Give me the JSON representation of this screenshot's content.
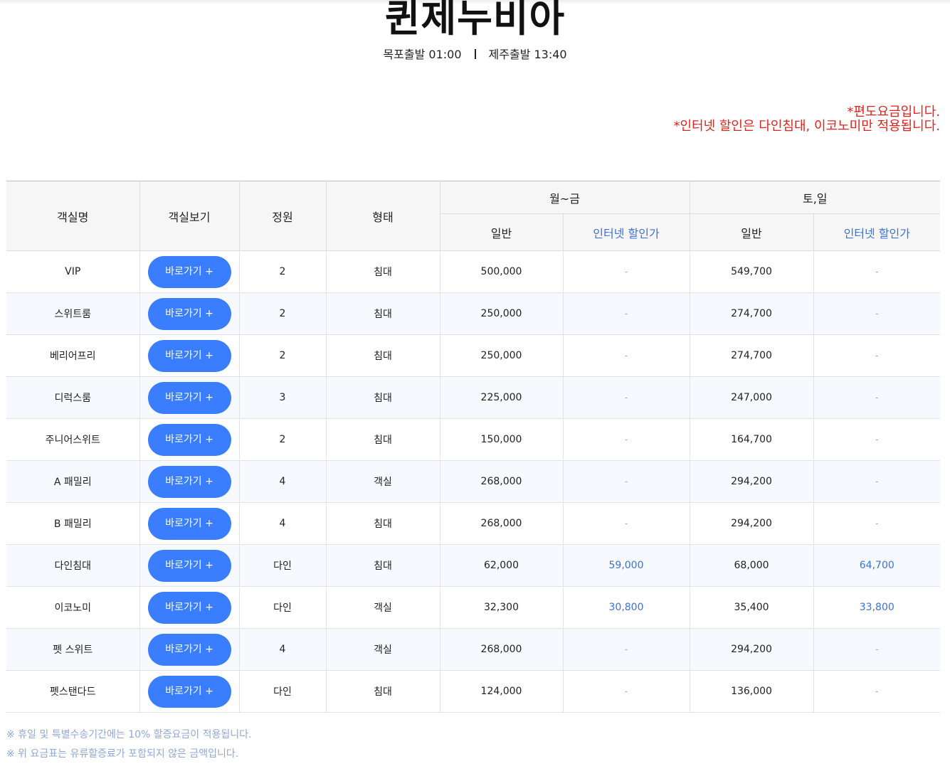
{
  "ship_name": "퀸제누비아",
  "schedule": {
    "depart_mokpo": "목포출발 01:00",
    "depart_jeju": "제주출발 13:40"
  },
  "notices": [
    "*편도요금입니다.",
    "*인터넷 할인은 다인침대, 이코노미만 적용됩니다."
  ],
  "table": {
    "headers": {
      "room_name": "객실명",
      "room_view": "객실보기",
      "capacity": "정원",
      "type": "형태",
      "weekday": "월~금",
      "weekend": "토,일",
      "regular": "일반",
      "internet": "인터넷 할인가"
    },
    "button_label": "바로가기 +",
    "rows": [
      {
        "name": "VIP",
        "capacity": "2",
        "type": "침대",
        "wd_regular": "500,000",
        "wd_internet": "-",
        "we_regular": "549,700",
        "we_internet": "-"
      },
      {
        "name": "스위트룸",
        "capacity": "2",
        "type": "침대",
        "wd_regular": "250,000",
        "wd_internet": "-",
        "we_regular": "274,700",
        "we_internet": "-"
      },
      {
        "name": "베리어프리",
        "capacity": "2",
        "type": "침대",
        "wd_regular": "250,000",
        "wd_internet": "-",
        "we_regular": "274,700",
        "we_internet": "-"
      },
      {
        "name": "디럭스룸",
        "capacity": "3",
        "type": "침대",
        "wd_regular": "225,000",
        "wd_internet": "-",
        "we_regular": "247,000",
        "we_internet": "-"
      },
      {
        "name": "주니어스위트",
        "capacity": "2",
        "type": "침대",
        "wd_regular": "150,000",
        "wd_internet": "-",
        "we_regular": "164,700",
        "we_internet": "-"
      },
      {
        "name": "A 패밀리",
        "capacity": "4",
        "type": "객실",
        "wd_regular": "268,000",
        "wd_internet": "-",
        "we_regular": "294,200",
        "we_internet": "-"
      },
      {
        "name": "B 패밀리",
        "capacity": "4",
        "type": "침대",
        "wd_regular": "268,000",
        "wd_internet": "-",
        "we_regular": "294,200",
        "we_internet": "-"
      },
      {
        "name": "다인침대",
        "capacity": "다인",
        "type": "침대",
        "wd_regular": "62,000",
        "wd_internet": "59,000",
        "we_regular": "68,000",
        "we_internet": "64,700"
      },
      {
        "name": "이코노미",
        "capacity": "다인",
        "type": "객실",
        "wd_regular": "32,300",
        "wd_internet": "30,800",
        "we_regular": "35,400",
        "we_internet": "33,800"
      },
      {
        "name": "펫 스위트",
        "capacity": "4",
        "type": "객실",
        "wd_regular": "268,000",
        "wd_internet": "-",
        "we_regular": "294,200",
        "we_internet": "-"
      },
      {
        "name": "펫스탠다드",
        "capacity": "다인",
        "type": "침대",
        "wd_regular": "124,000",
        "wd_internet": "-",
        "we_regular": "136,000",
        "we_internet": "-"
      }
    ]
  },
  "footnotes": [
    "※ 휴일 및 특별수송기간에는 10% 할증요금이 적용됩니다.",
    "※ 위 요금표는 유류할증료가 포함되지 않은 금액입니다."
  ],
  "colors": {
    "accent_button": "#3a7dff",
    "notice_red": "#e0231c",
    "discount_blue": "#3d72d8",
    "footnote_blue": "#8fa8d6"
  }
}
